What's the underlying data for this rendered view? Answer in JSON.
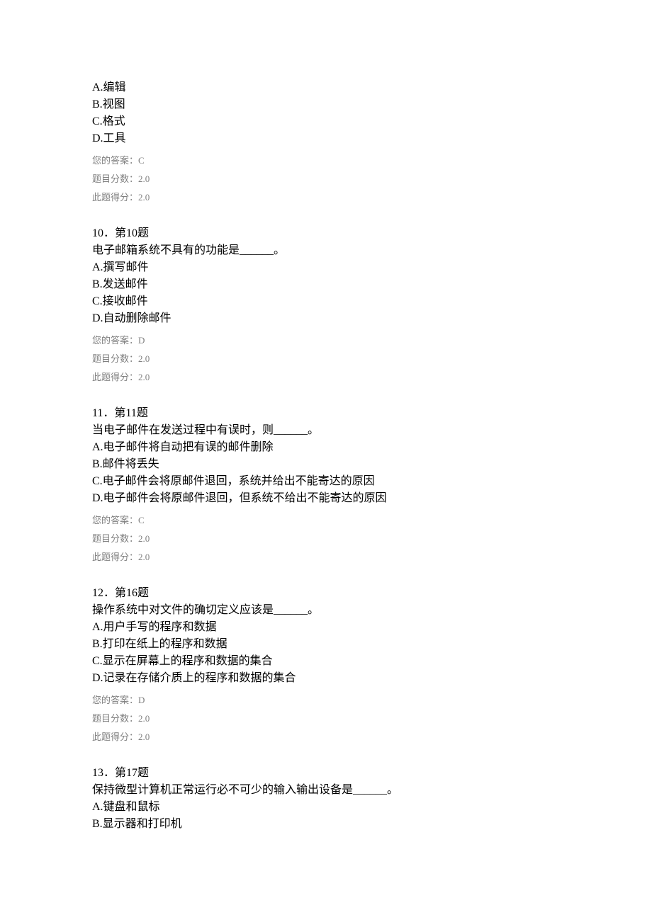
{
  "questions": [
    {
      "header": "",
      "stem": "",
      "options": [
        "A.编辑",
        "B.视图",
        "C.格式",
        "D.工具"
      ],
      "answer": "您的答案：C",
      "score": "题目分数：2.0",
      "earned": "此题得分：2.0"
    },
    {
      "header": "10．第10题",
      "stem": "电子邮箱系统不具有的功能是______。",
      "options": [
        "A.撰写邮件",
        "B.发送邮件",
        "C.接收邮件",
        "D.自动删除邮件"
      ],
      "answer": "您的答案：D",
      "score": "题目分数：2.0",
      "earned": "此题得分：2.0"
    },
    {
      "header": "11．第11题",
      "stem": "当电子邮件在发送过程中有误时，则______。",
      "options": [
        "A.电子邮件将自动把有误的邮件删除",
        "B.邮件将丢失",
        "C.电子邮件会将原邮件退回，系统并给出不能寄达的原因",
        "D.电子邮件会将原邮件退回，但系统不给出不能寄达的原因"
      ],
      "answer": "您的答案：C",
      "score": "题目分数：2.0",
      "earned": "此题得分：2.0"
    },
    {
      "header": "12．第16题",
      "stem": "操作系统中对文件的确切定义应该是______。",
      "options": [
        "A.用户手写的程序和数据",
        "B.打印在纸上的程序和数据",
        "C.显示在屏幕上的程序和数据的集合",
        "D.记录在存储介质上的程序和数据的集合"
      ],
      "answer": "您的答案：D",
      "score": "题目分数：2.0",
      "earned": "此题得分：2.0"
    },
    {
      "header": "13．第17题",
      "stem": "保持微型计算机正常运行必不可少的输入输出设备是______。",
      "options": [
        "A.键盘和鼠标",
        "B.显示器和打印机"
      ],
      "answer": "",
      "score": "",
      "earned": ""
    }
  ]
}
